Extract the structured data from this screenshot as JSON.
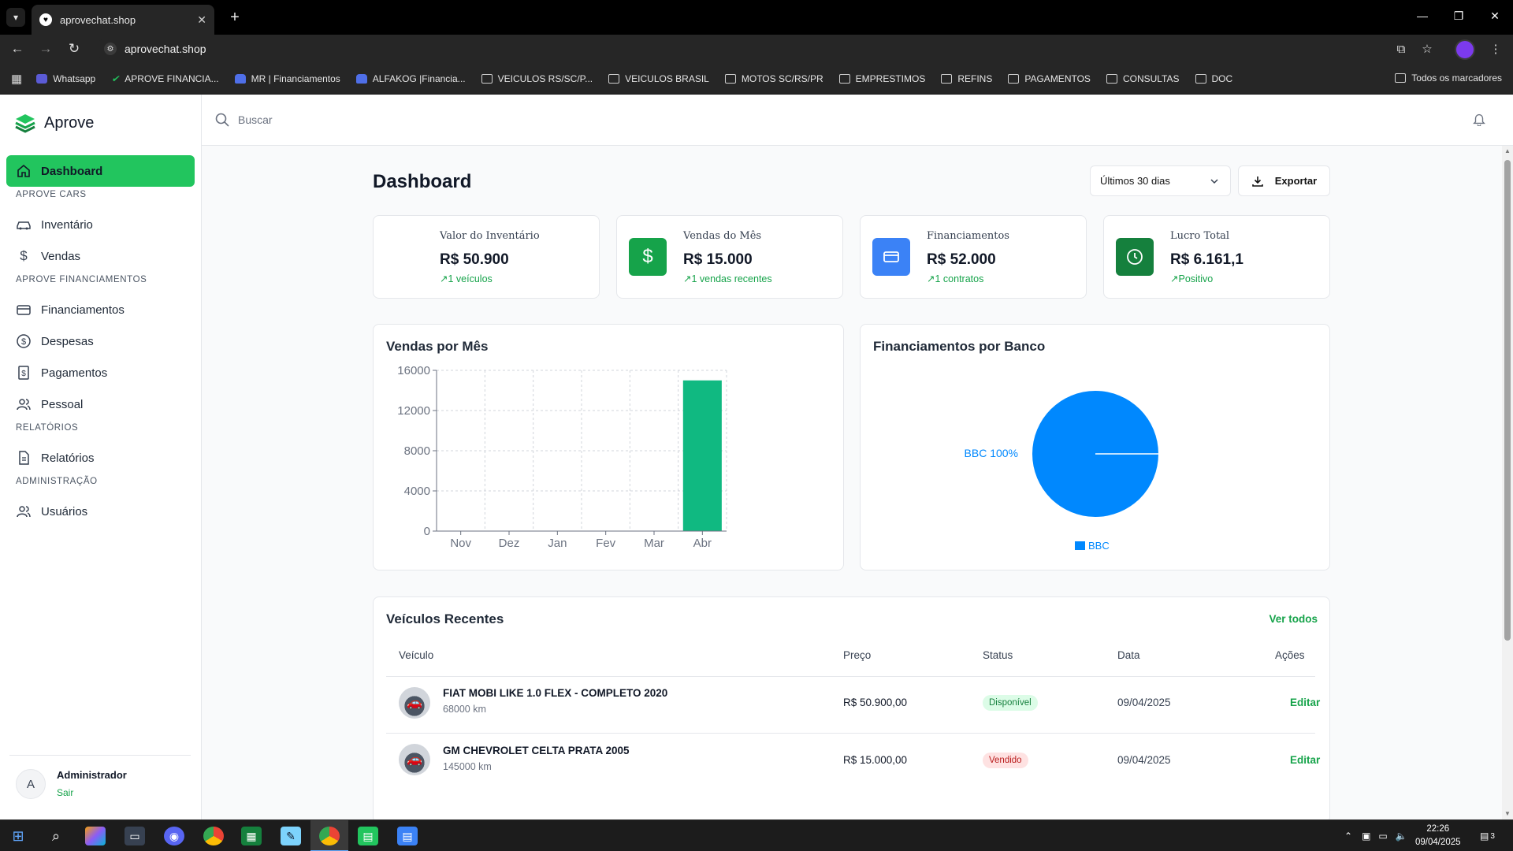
{
  "browser": {
    "tab_title": "aprovechat.shop",
    "url": "aprovechat.shop",
    "bookmarks": [
      {
        "label": "Whatsapp",
        "icon": "whatsapp-icon"
      },
      {
        "label": "APROVE FINANCIA...",
        "icon": "check-icon"
      },
      {
        "label": "MR | Financiamentos",
        "icon": "car-icon"
      },
      {
        "label": "ALFAKOG |Financia...",
        "icon": "car-icon"
      },
      {
        "label": "VEICULOS RS/SC/P...",
        "icon": "folder-icon"
      },
      {
        "label": "VEICULOS BRASIL",
        "icon": "folder-icon"
      },
      {
        "label": "MOTOS SC/RS/PR",
        "icon": "folder-icon"
      },
      {
        "label": "EMPRESTIMOS",
        "icon": "folder-icon"
      },
      {
        "label": "REFINS",
        "icon": "folder-icon"
      },
      {
        "label": "PAGAMENTOS",
        "icon": "folder-icon"
      },
      {
        "label": "CONSULTAS",
        "icon": "folder-icon"
      },
      {
        "label": "DOC",
        "icon": "folder-icon"
      }
    ],
    "all_bookmarks": "Todos os marcadores"
  },
  "app": {
    "brand": "Aprove",
    "accent_color": "#22c55e",
    "search_placeholder": "Buscar"
  },
  "sidebar": {
    "active": {
      "label": "Dashboard",
      "icon": "home-icon"
    },
    "sections": {
      "cars": "APROVE CARS",
      "financing": "APROVE FINANCIAMENTOS",
      "reports": "RELATÓRIOS",
      "admin": "ADMINISTRAÇÃO"
    },
    "items": {
      "inventory": "Inventário",
      "sales": "Vendas",
      "financing": "Financiamentos",
      "expenses": "Despesas",
      "payments": "Pagamentos",
      "personal": "Pessoal",
      "reports": "Relatórios",
      "users": "Usuários"
    },
    "user": {
      "initial": "A",
      "name": "Administrador",
      "logout": "Sair"
    }
  },
  "dashboard": {
    "title": "Dashboard",
    "range": "Últimos 30 dias",
    "export": "Exportar",
    "stats": [
      {
        "label": "Valor do Inventário",
        "value": "R$ 50.900",
        "trend": "1 veículos",
        "color": "#ffffff",
        "icon": "none"
      },
      {
        "label": "Vendas do Mês",
        "value": "R$ 15.000",
        "trend": "1 vendas recentes",
        "color": "#16a34a",
        "icon": "dollar-icon"
      },
      {
        "label": "Financiamentos",
        "value": "R$ 52.000",
        "trend": "1 contratos",
        "color": "#3b82f6",
        "icon": "credit-card-icon"
      },
      {
        "label": "Lucro Total",
        "value": "R$ 6.161,1",
        "trend": "Positivo",
        "color": "#15803d",
        "icon": "clock-icon"
      }
    ],
    "sales_chart_title": "Vendas por Mês",
    "bank_chart_title": "Financiamentos por Banco",
    "recent": {
      "title": "Veículos Recentes",
      "see_all": "Ver todos",
      "columns": [
        "Veículo",
        "Preço",
        "Status",
        "Data",
        "Ações"
      ],
      "rows": [
        {
          "name": "FIAT MOBI LIKE 1.0 FLEX - COMPLETO 2020",
          "km": "68000 km",
          "price": "R$ 50.900,00",
          "status": "Disponível",
          "status_kind": "available",
          "date": "09/04/2025",
          "action": "Editar"
        },
        {
          "name": "GM CHEVROLET CELTA PRATA 2005",
          "km": "145000 km",
          "price": "R$ 15.000,00",
          "status": "Vendido",
          "status_kind": "sold",
          "date": "09/04/2025",
          "action": "Editar"
        }
      ]
    }
  },
  "chart_data": [
    {
      "type": "bar",
      "title": "Vendas por Mês",
      "categories": [
        "Nov",
        "Dez",
        "Jan",
        "Fev",
        "Mar",
        "Abr"
      ],
      "values": [
        0,
        0,
        0,
        0,
        0,
        15000
      ],
      "ylim": [
        0,
        16000
      ],
      "yticks": [
        0,
        4000,
        8000,
        12000,
        16000
      ],
      "grid": true,
      "color": "#10b981"
    },
    {
      "type": "pie",
      "title": "Financiamentos por Banco",
      "labels": [
        "BBC"
      ],
      "values": [
        100
      ],
      "slice_label": "BBC 100%",
      "legend": [
        "BBC"
      ],
      "legend_position": "bottom",
      "color": "#0088fe"
    }
  ],
  "taskbar": {
    "time": "22:26",
    "date": "09/04/2025",
    "notifications": "3"
  }
}
